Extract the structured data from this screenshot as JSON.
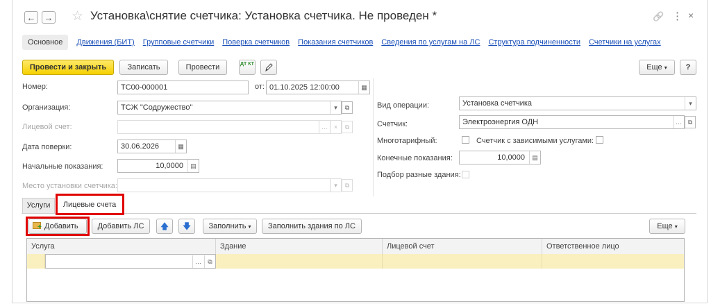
{
  "window": {
    "title": "Установка\\снятие счетчика: Установка счетчика. Не проведен *",
    "back_icon": "←",
    "forward_icon": "→",
    "star_icon": "☆",
    "link_icon": "🔗",
    "menu_icon": "⋮",
    "close_icon": "×"
  },
  "tabs": {
    "main": "Основное",
    "links": [
      "Движения (БИТ)",
      "Групповые счетчики",
      "Поверка счетчиков",
      "Показания счетчиков",
      "Сведения по услугам на ЛС",
      "Структура подчиненности",
      "Счетчики на услугах"
    ]
  },
  "toolbar": {
    "post_close": "Провести и закрыть",
    "save": "Записать",
    "post": "Провести",
    "dtkt": "ДТ КТ",
    "more": "Еще",
    "help": "?"
  },
  "form": {
    "number_label": "Номер:",
    "number_value": "ТС00-000001",
    "date_label": "от:",
    "date_value": "01.10.2025 12:00:00",
    "org_label": "Организация:",
    "org_value": "ТСЖ \"Содружество\"",
    "account_label": "Лицевой счет:",
    "check_date_label": "Дата поверки:",
    "check_date_value": "30.06.2026",
    "initial_label": "Начальные показания:",
    "initial_value": "10,0000",
    "place_label": "Место установки счетчика:",
    "op_label": "Вид операции:",
    "op_value": "Установка счетчика",
    "meter_label": "Счетчик:",
    "meter_value": "Электроэнергия ОДН",
    "multitariff_label": "Многотарифный:",
    "dependent_label": "Счетчик с зависимыми услугами:",
    "final_label": "Конечные показания:",
    "final_value": "10,0000",
    "buildings_label": "Подбор разные здания:"
  },
  "subtabs": [
    "Услуги",
    "Лицевые счета"
  ],
  "subtoolbar": {
    "add": "Добавить",
    "add_ls": "Добавить ЛС",
    "fill": "Заполнить",
    "fill_buildings": "Заполнить здания по ЛС",
    "more": "Еще"
  },
  "table": {
    "columns": [
      "Услуга",
      "Здание",
      "Лицевой счет",
      "Ответственное лицо"
    ]
  },
  "colors": {
    "accent_yellow": "#f5d000",
    "highlight_red": "#e00000",
    "link_blue": "#1a4fb8",
    "row_yellow": "#faf0bf"
  }
}
